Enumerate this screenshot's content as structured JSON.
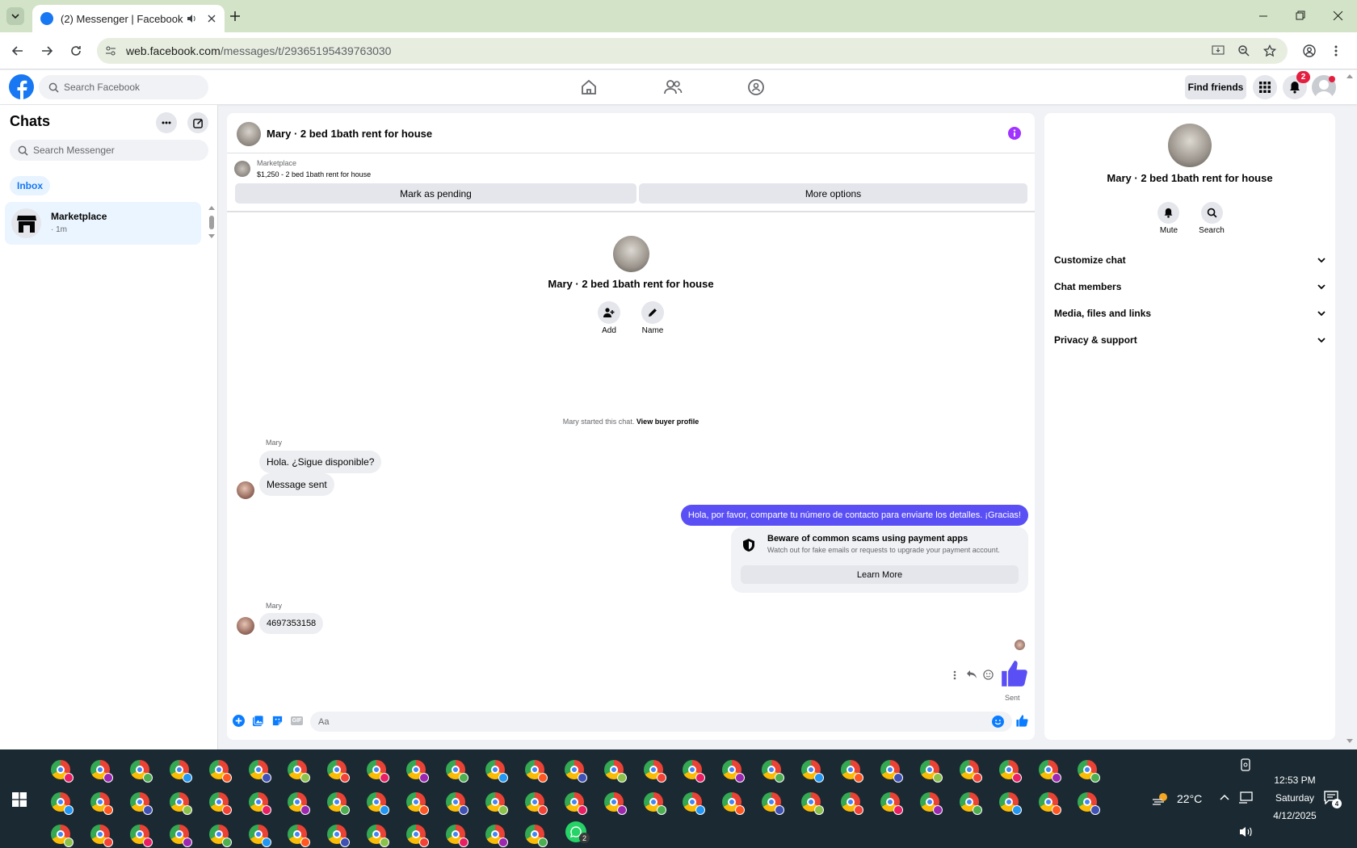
{
  "browser": {
    "tab_title": "(2) Messenger | Facebook",
    "url_host": "web.facebook.com",
    "url_path": "/messages/t/29365195439763030"
  },
  "fb_header": {
    "search_placeholder": "Search Facebook",
    "find_friends": "Find friends",
    "notifications_badge": "2"
  },
  "sidebar": {
    "title": "Chats",
    "search_placeholder": "Search Messenger",
    "filter_chip": "Inbox",
    "chats": [
      {
        "name": "Marketplace",
        "time": "· 1m"
      }
    ]
  },
  "conversation": {
    "title": "Mary · 2 bed 1bath rent for house",
    "listing_source": "Marketplace",
    "listing_title": "$1,250 - 2 bed 1bath rent for house",
    "mark_pending": "Mark as pending",
    "more_options": "More options",
    "intro_name": "Mary · 2 bed 1bath rent for house",
    "intro_add": "Add",
    "intro_name_label": "Name",
    "started_text": "Mary started this chat.",
    "view_buyer": "View buyer profile",
    "messages": [
      {
        "sender": "Mary",
        "text": "Hola. ¿Sigue disponible?"
      },
      {
        "text": "Message sent"
      },
      {
        "text": "Hola, por favor, comparte tu número de contacto para enviarte los detalles. ¡Gracias!"
      },
      {
        "sender": "Mary",
        "text": "4697353158"
      }
    ],
    "scam_warning": {
      "title": "Beware of common scams using payment apps",
      "body": "Watch out for fake emails or requests to upgrade your payment account.",
      "button": "Learn More"
    },
    "sent_status": "Sent",
    "composer_placeholder": "Aa"
  },
  "info_panel": {
    "name": "Mary · 2 bed 1bath rent for house",
    "mute": "Mute",
    "search": "Search",
    "sections": [
      "Customize chat",
      "Chat members",
      "Media, files and links",
      "Privacy & support"
    ]
  },
  "taskbar": {
    "weather": "22°C",
    "time": "12:53 PM",
    "day": "Saturday",
    "date": "4/12/2025",
    "notification_count": "4",
    "whatsapp_badge": "2"
  }
}
